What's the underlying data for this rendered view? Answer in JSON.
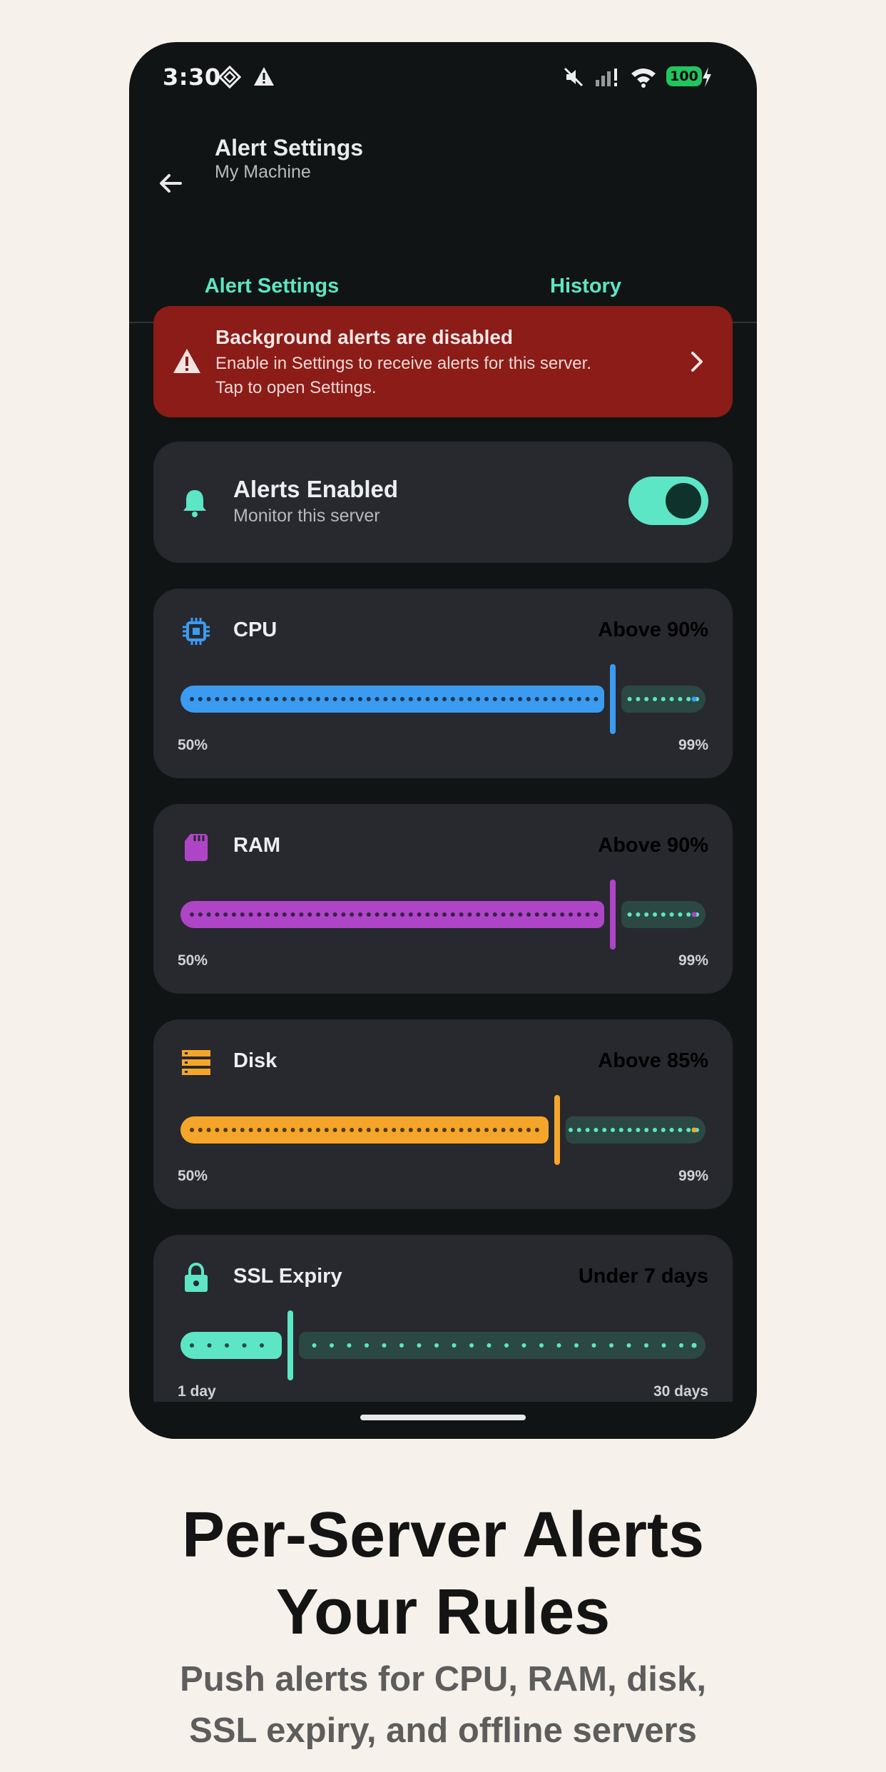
{
  "status_bar": {
    "time": "3:30",
    "battery": "100"
  },
  "app_bar": {
    "title": "Alert Settings",
    "subtitle": "My Machine"
  },
  "tabs": [
    {
      "label": "Alert Settings",
      "selected": true
    },
    {
      "label": "History",
      "selected": false
    }
  ],
  "warning_banner": {
    "title": "Background alerts are disabled",
    "line1": "Enable in Settings to receive alerts for this server.",
    "line2": "Tap to open Settings."
  },
  "alerts_toggle": {
    "title": "Alerts Enabled",
    "subtitle": "Monitor this server",
    "enabled": true
  },
  "metrics": [
    {
      "name": "CPU",
      "value_label": "Above 90%",
      "min_label": "50%",
      "max_label": "99%",
      "fraction": 0.82,
      "color": "#3b9bf0",
      "icon": "cpu-icon"
    },
    {
      "name": "RAM",
      "value_label": "Above 90%",
      "min_label": "50%",
      "max_label": "99%",
      "fraction": 0.82,
      "color": "#ae45c6",
      "icon": "memory-card-icon"
    },
    {
      "name": "Disk",
      "value_label": "Above 85%",
      "min_label": "50%",
      "max_label": "99%",
      "fraction": 0.714,
      "color": "#f5a62a",
      "icon": "storage-icon"
    },
    {
      "name": "SSL Expiry",
      "value_label": "Under 7 days",
      "min_label": "1 day",
      "max_label": "30 days",
      "fraction": 0.207,
      "color": "#5ce6c5",
      "icon": "lock-icon"
    }
  ],
  "marketing": {
    "headline_line1": "Per-Server Alerts",
    "headline_line2": "Your Rules",
    "sub_line1": "Push alerts for CPU, RAM, disk,",
    "sub_line2": "SSL expiry, and offline servers"
  },
  "colors": {
    "accent": "#5ce6c5",
    "warning_bg": "#8b1c17",
    "card_bg": "#28282f",
    "screen_bg": "#111414",
    "page_bg": "#f6f1ea"
  }
}
